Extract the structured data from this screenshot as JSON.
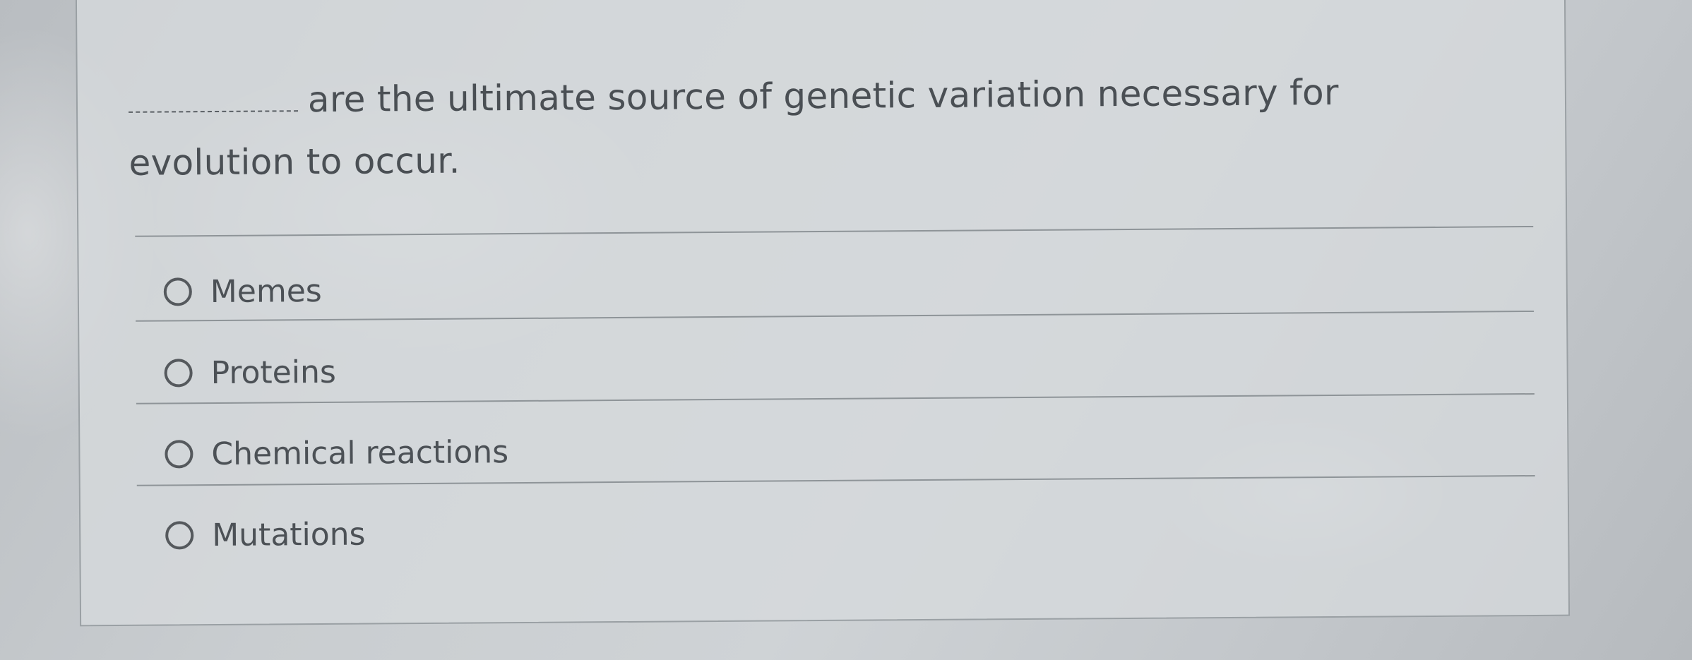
{
  "question": {
    "blank": "__________",
    "text": "are the ultimate source of genetic variation necessary for evolution to occur."
  },
  "options": [
    {
      "label": "Memes",
      "selected": false
    },
    {
      "label": "Proteins",
      "selected": false
    },
    {
      "label": "Chemical reactions",
      "selected": false
    },
    {
      "label": "Mutations",
      "selected": false
    }
  ]
}
